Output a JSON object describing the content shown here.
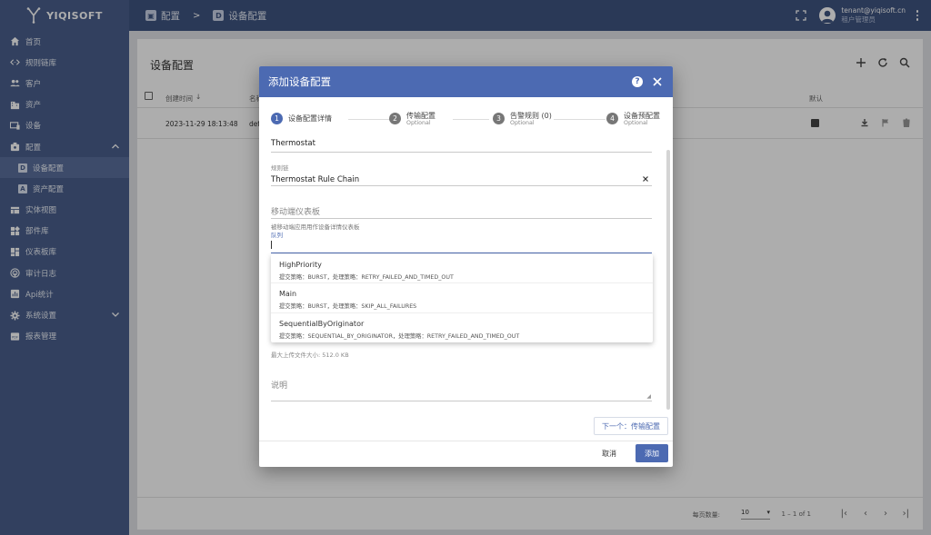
{
  "brand": {
    "name": "YIQISOFT"
  },
  "sidebar": {
    "items": [
      {
        "label": "首页",
        "icon": "home-icon"
      },
      {
        "label": "规则链库",
        "icon": "code-icon"
      },
      {
        "label": "客户",
        "icon": "people-icon"
      },
      {
        "label": "资产",
        "icon": "domain-icon"
      },
      {
        "label": "设备",
        "icon": "devices-icon"
      },
      {
        "label": "配置",
        "icon": "settings-box-icon"
      },
      {
        "label": "设备配置",
        "icon": "device-profile-icon",
        "badge": "D"
      },
      {
        "label": "资产配置",
        "icon": "asset-profile-icon",
        "badge": "A"
      },
      {
        "label": "实体视图",
        "icon": "view-icon"
      },
      {
        "label": "部件库",
        "icon": "widgets-icon"
      },
      {
        "label": "仪表板库",
        "icon": "dashboard-icon"
      },
      {
        "label": "审计日志",
        "icon": "audit-icon"
      },
      {
        "label": "Api统计",
        "icon": "api-icon"
      },
      {
        "label": "系统设置",
        "icon": "gear-icon"
      },
      {
        "label": "报表管理",
        "icon": "report-icon"
      }
    ]
  },
  "topbar": {
    "crumb1": "配置",
    "sep": ">",
    "crumb2": "设备配置",
    "crumb2_badge": "D",
    "user_email": "tenant@yiqisoft.cn",
    "user_role": "租户管理员"
  },
  "page": {
    "title": "设备配置",
    "col_created": "创建时间",
    "col_name": "名称",
    "col_default": "默认",
    "row_created": "2023-11-29 18:13:48",
    "row_name": "default",
    "page_size_label": "每页数量:",
    "page_size": "10",
    "range": "1 – 1 of 1"
  },
  "dialog": {
    "title": "添加设备配置",
    "help": "?",
    "steps": [
      {
        "num": "1",
        "label": "设备配置详情",
        "optional": ""
      },
      {
        "num": "2",
        "label": "传输配置",
        "optional": "Optional"
      },
      {
        "num": "3",
        "label": "告警规则 (0)",
        "optional": "Optional"
      },
      {
        "num": "4",
        "label": "设备预配置",
        "optional": "Optional"
      }
    ],
    "name_value": "Thermostat",
    "rule_chain_label": "规则链",
    "rule_chain_value": "Thermostat Rule Chain",
    "mobile_dashboard_placeholder": "移动端仪表板",
    "mobile_dashboard_hint": "被移动端应用用作设备详情仪表板",
    "queue_label": "队列",
    "queue_options": [
      {
        "title": "HighPriority",
        "desc": "提交策略：BURST，处理策略：RETRY_FAILED_AND_TIMED_OUT"
      },
      {
        "title": "Main",
        "desc": "提交策略：BURST，处理策略：SKIP_ALL_FAILURES"
      },
      {
        "title": "SequentialByOriginator",
        "desc": "提交策略：SEQUENTIAL_BY_ORIGINATOR，处理策略：RETRY_FAILED_AND_TIMED_OUT"
      }
    ],
    "max_file_size": "最大上传文件大小: 512.0 KB",
    "description_placeholder": "说明",
    "next_button": "下一个：传输配置",
    "cancel_button": "取消",
    "add_button": "添加"
  },
  "colors": {
    "sidebar": "#4a5f8c",
    "topbar": "#3f5481",
    "accent": "#4c6ab2"
  }
}
